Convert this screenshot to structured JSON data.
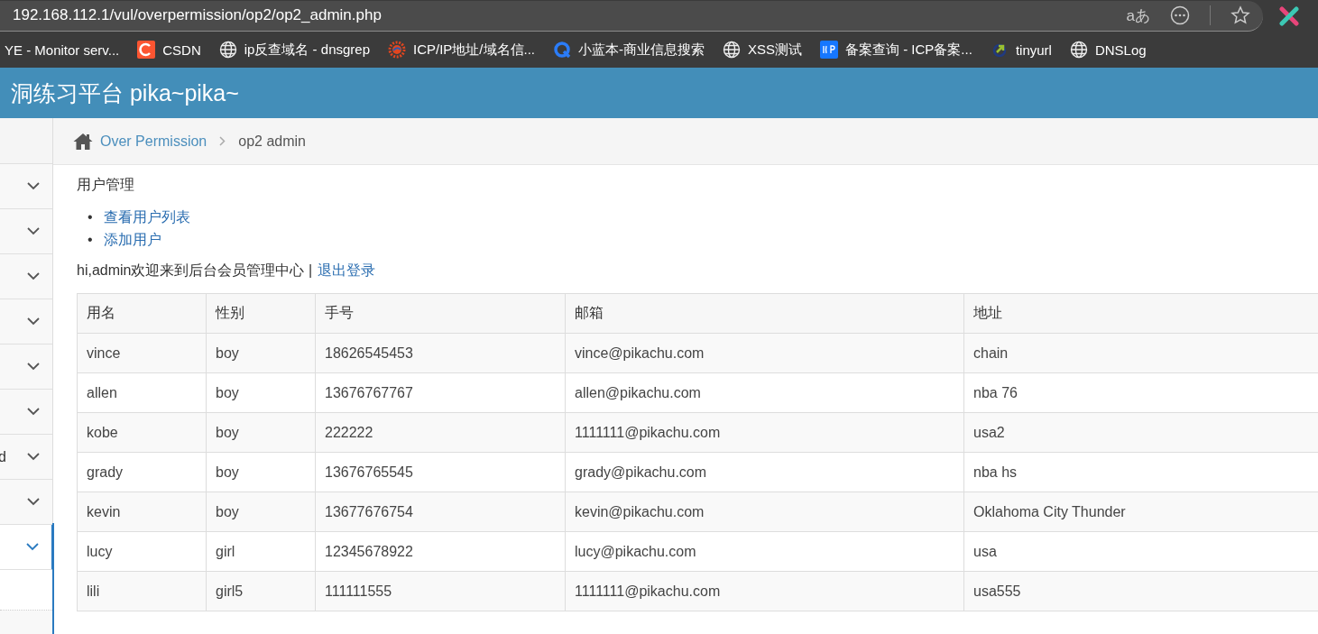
{
  "browser": {
    "url": "192.168.112.1/vul/overpermission/op2/op2_admin.php",
    "read_aloud": "aあ"
  },
  "bookmarks": [
    {
      "kind": "none",
      "label": "YE - Monitor serv..."
    },
    {
      "kind": "csdn",
      "label": "CSDN"
    },
    {
      "kind": "globe",
      "label": "ip反查域名 - dnsgrep"
    },
    {
      "kind": "gear",
      "label": "ICP/IP地址/域名信..."
    },
    {
      "kind": "q",
      "label": "小蓝本-商业信息搜索"
    },
    {
      "kind": "globe",
      "label": "XSS测试"
    },
    {
      "kind": "icp",
      "label": "备案查询 - ICP备案..."
    },
    {
      "kind": "link",
      "label": "tinyurl"
    },
    {
      "kind": "globe",
      "label": "DNSLog"
    }
  ],
  "header": {
    "title": "洞练习平台 pika~pika~"
  },
  "sidebar": {
    "items": [
      {
        "selected": false
      },
      {
        "selected": false
      },
      {
        "selected": false
      },
      {
        "selected": false
      },
      {
        "selected": false
      },
      {
        "selected": false
      },
      {
        "label": "d",
        "selected": false
      },
      {
        "selected": false
      },
      {
        "selected": true
      }
    ]
  },
  "breadcrumb": {
    "parent": "Over Permission",
    "current": "op2 admin"
  },
  "content": {
    "heading": "用户管理",
    "bullet": "•",
    "links": [
      "查看用户列表",
      "添加用户"
    ],
    "welcome": "hi,admin欢迎来到后台会员管理中心 |",
    "logout": "退出登录"
  },
  "table": {
    "columns": [
      "用名",
      "性别",
      "手号",
      "邮箱",
      "地址"
    ],
    "rows": [
      [
        "vince",
        "boy",
        "18626545453",
        "vince@pikachu.com",
        "chain"
      ],
      [
        "allen",
        "boy",
        "13676767767",
        "allen@pikachu.com",
        "nba 76"
      ],
      [
        "kobe",
        "boy",
        "222222",
        "1111111@pikachu.com",
        "usa2"
      ],
      [
        "grady",
        "boy",
        "13676765545",
        "grady@pikachu.com",
        "nba hs"
      ],
      [
        "kevin",
        "boy",
        "13677676754",
        "kevin@pikachu.com",
        "Oklahoma City Thunder"
      ],
      [
        "lucy",
        "girl",
        "12345678922",
        "lucy@pikachu.com",
        "usa"
      ],
      [
        "lili",
        "girl5",
        "111111555",
        "1111111@pikachu.com",
        "usa555"
      ]
    ]
  }
}
